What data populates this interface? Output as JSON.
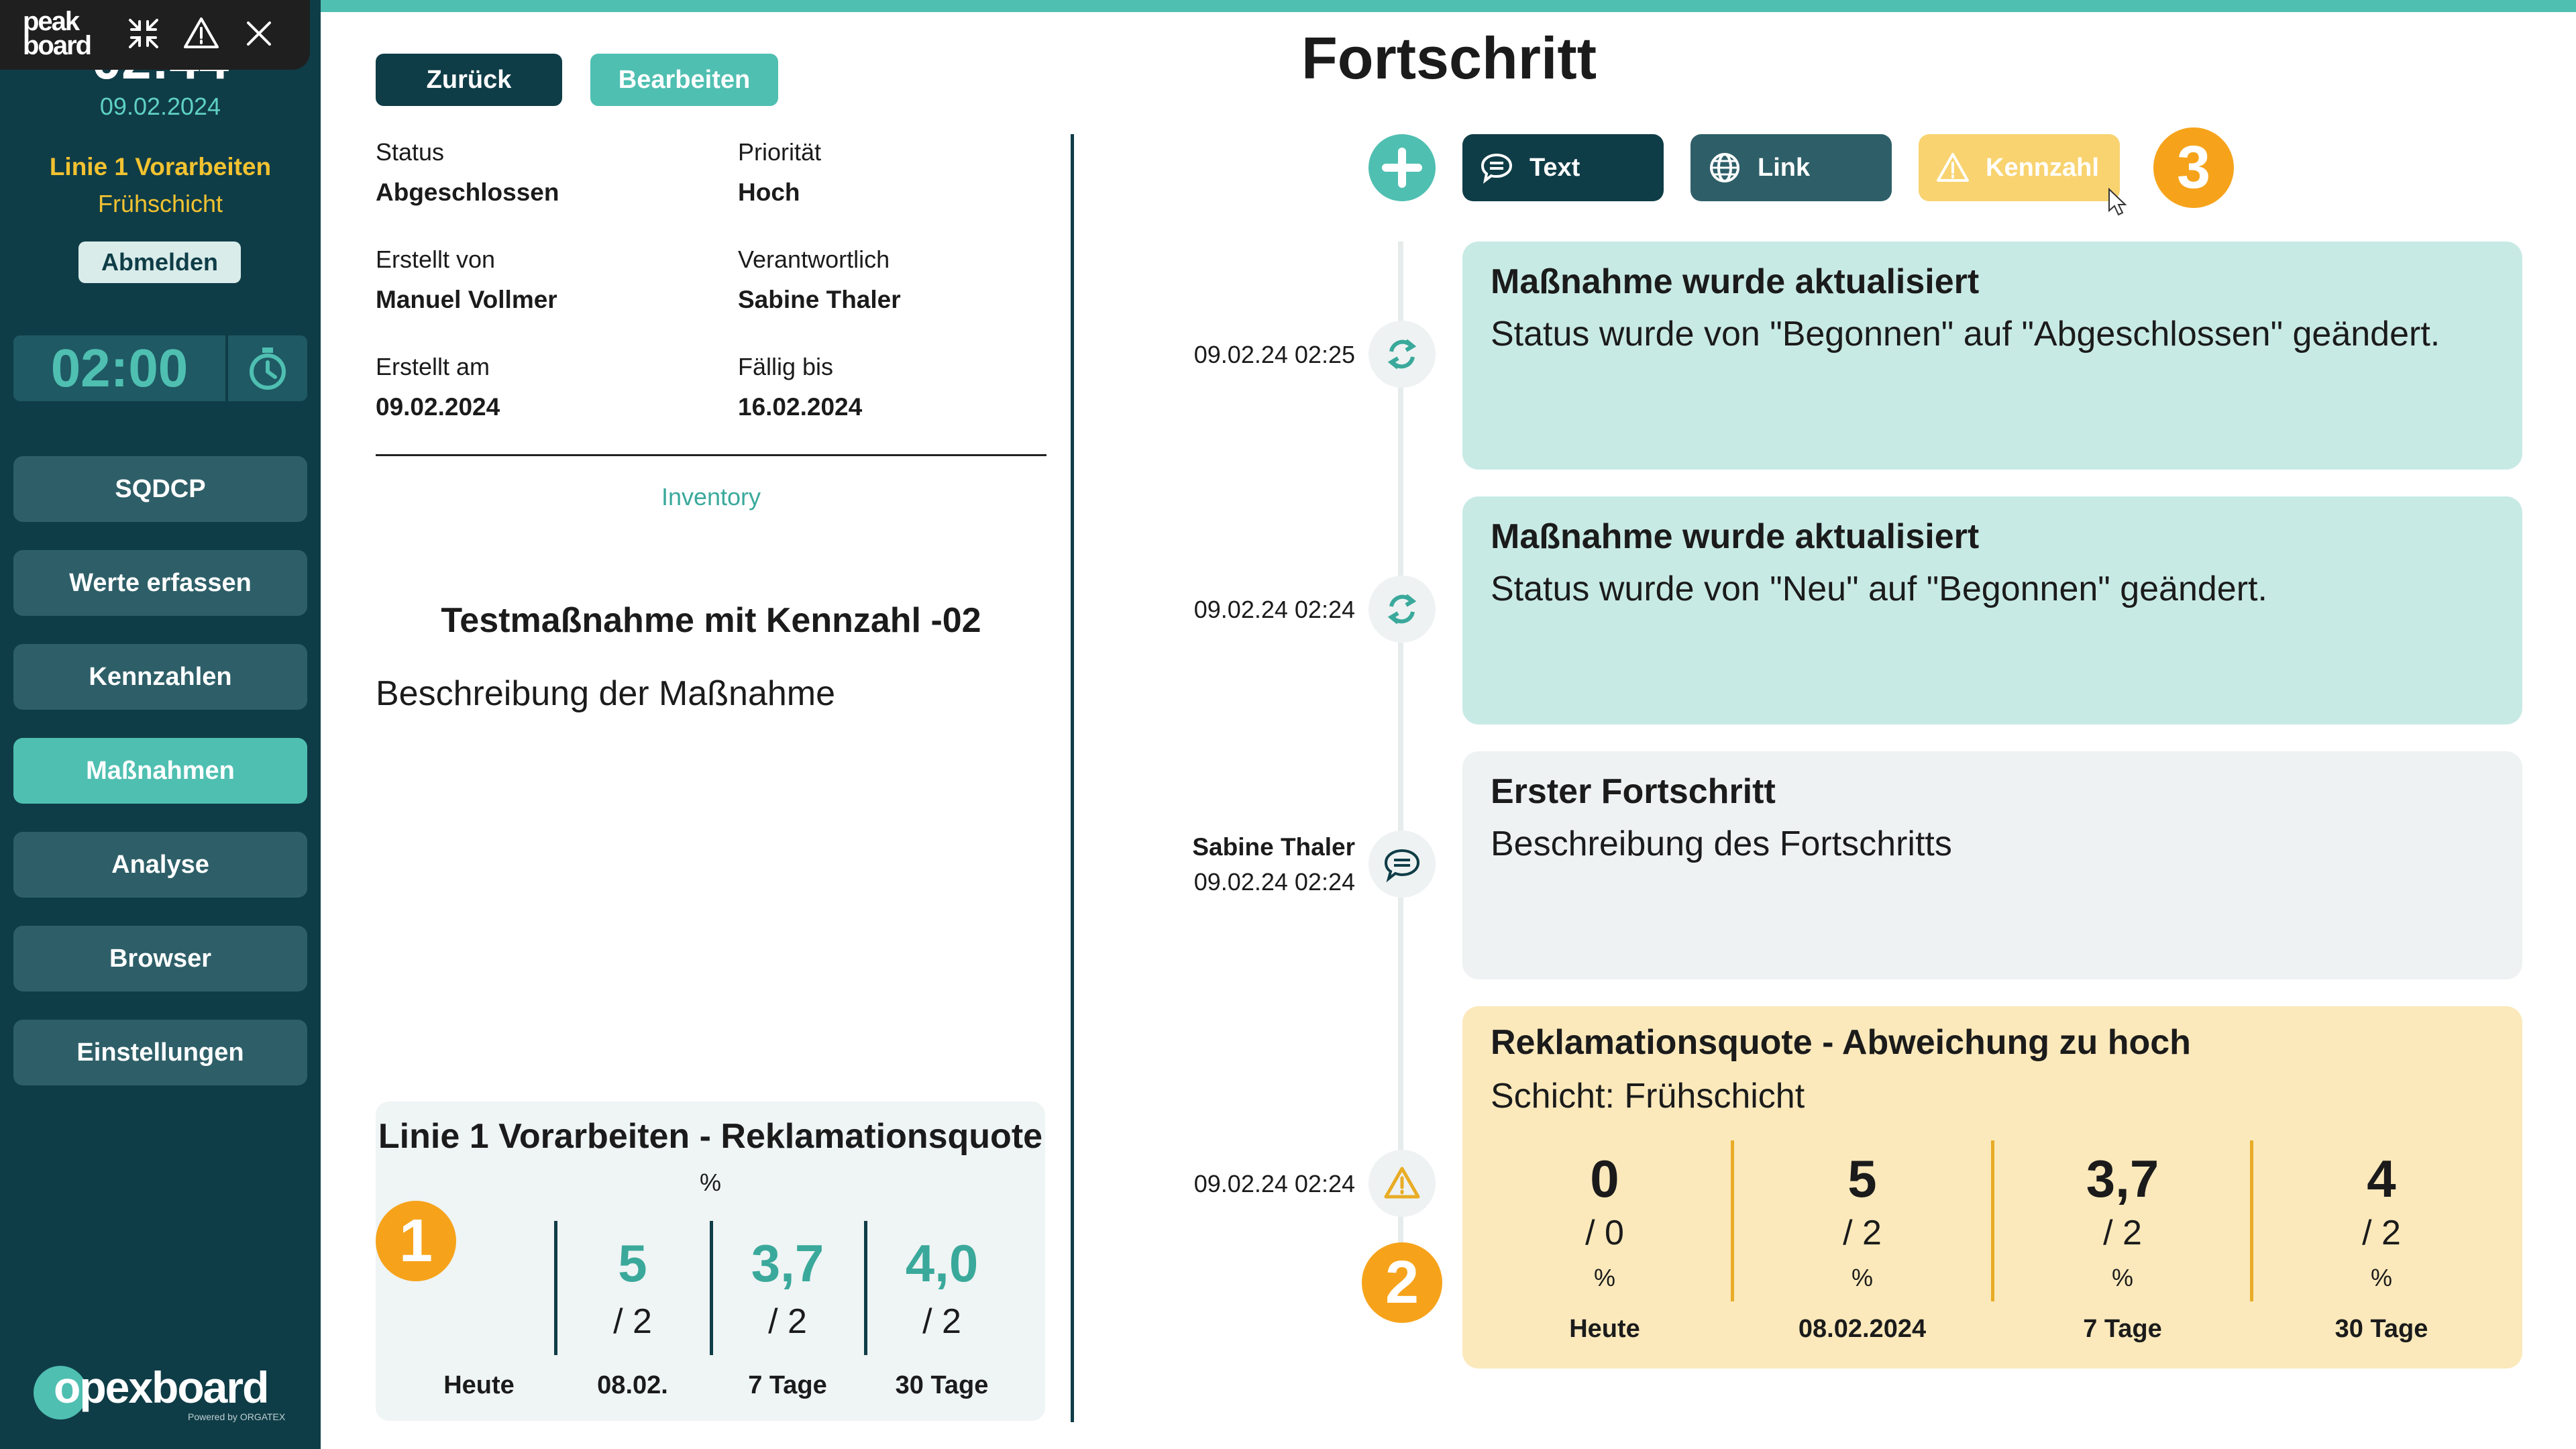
{
  "app": {
    "brand": "peak board",
    "footer_brand": "opexboard",
    "footer_sub": "Powered by ORGATEX"
  },
  "sidebar": {
    "clock_partial": "02:44",
    "date": "09.02.2024",
    "line": "Linie 1 Vorarbeiten",
    "shift": "Frühschicht",
    "logout": "Abmelden",
    "timer": "02:00",
    "items": [
      {
        "label": "SQDCP",
        "active": false
      },
      {
        "label": "Werte erfassen",
        "active": false
      },
      {
        "label": "Kennzahlen",
        "active": false
      },
      {
        "label": "Maßnahmen",
        "active": true
      },
      {
        "label": "Analyse",
        "active": false
      },
      {
        "label": "Browser",
        "active": false
      },
      {
        "label": "Einstellungen",
        "active": false
      }
    ]
  },
  "toolbar": {
    "back": "Zurück",
    "edit": "Bearbeiten"
  },
  "details": {
    "status_label": "Status",
    "status": "Abgeschlossen",
    "priority_label": "Priorität",
    "priority": "Hoch",
    "created_by_label": "Erstellt von",
    "created_by": "Manuel Vollmer",
    "responsible_label": "Verantwortlich",
    "responsible": "Sabine Thaler",
    "created_at_label": "Erstellt am",
    "created_at": "09.02.2024",
    "due_label": "Fällig bis",
    "due": "16.02.2024",
    "category": "Inventory",
    "title": "Testmaßnahme mit Kennzahl -02",
    "description": "Beschreibung der Maßnahme"
  },
  "kpi_card": {
    "title": "Linie 1 Vorarbeiten - Reklamationsquote",
    "unit": "%",
    "columns": [
      {
        "value": "",
        "target": "",
        "label": "Heute"
      },
      {
        "value": "5",
        "target": "/ 2",
        "label": "08.02."
      },
      {
        "value": "3,7",
        "target": "/ 2",
        "label": "7 Tage"
      },
      {
        "value": "4,0",
        "target": "/ 2",
        "label": "30 Tage"
      }
    ]
  },
  "markers": [
    "1",
    "2",
    "3"
  ],
  "progress": {
    "title": "Fortschritt",
    "buttons": {
      "text": "Text",
      "link": "Link",
      "kpi": "Kennzahl"
    },
    "entries": [
      {
        "time": "09.02.24 02:25",
        "title": "Maßnahme wurde aktualisiert",
        "text": "Status wurde von \"Begonnen\" auf \"Abgeschlossen\" geändert."
      },
      {
        "time": "09.02.24 02:24",
        "title": "Maßnahme wurde aktualisiert",
        "text": "Status wurde von \"Neu\" auf \"Begonnen\" geändert."
      },
      {
        "author": "Sabine Thaler",
        "time": "09.02.24 02:24",
        "title": "Erster Fortschritt",
        "text": "Beschreibung des Fortschritts"
      },
      {
        "time": "09.02.24 02:24",
        "title": "Reklamationsquote - Abweichung zu hoch",
        "text": "Schicht: Frühschicht",
        "columns": [
          {
            "value": "0",
            "target": "/ 0",
            "unit": "%",
            "label": "Heute"
          },
          {
            "value": "5",
            "target": "/ 2",
            "unit": "%",
            "label": "08.02.2024"
          },
          {
            "value": "3,7",
            "target": "/ 2",
            "unit": "%",
            "label": "7 Tage"
          },
          {
            "value": "4",
            "target": "/ 2",
            "unit": "%",
            "label": "30 Tage"
          }
        ]
      }
    ]
  },
  "colors": {
    "sidebar": "#0f3d47",
    "accent": "#4fbfb1",
    "warning": "#f8d370",
    "marker": "#f6a31b"
  }
}
